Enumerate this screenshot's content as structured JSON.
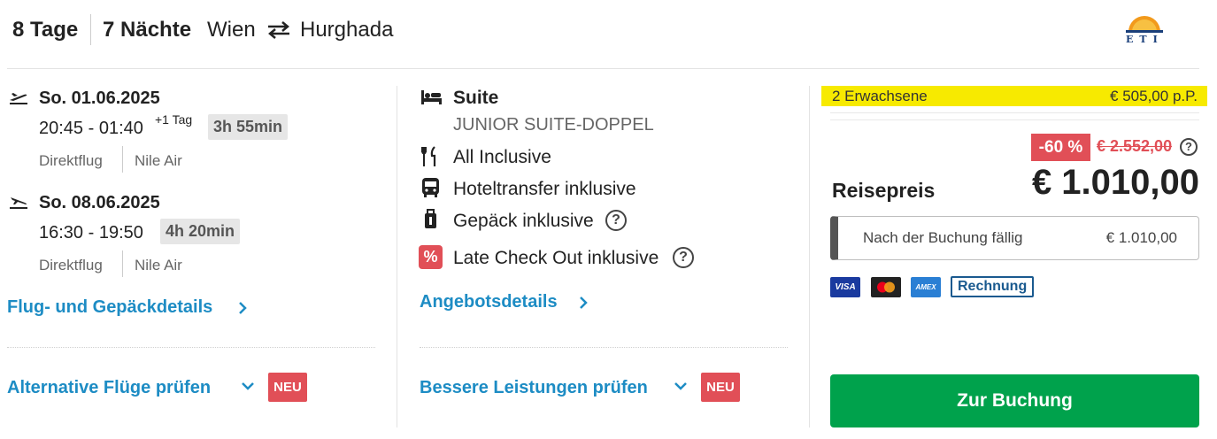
{
  "header": {
    "days": "8 Tage",
    "nights": "7 Nächte",
    "from": "Wien",
    "to": "Hurghada",
    "route_icon": "swap-arrows-icon",
    "logo_text": "ETI"
  },
  "flights": [
    {
      "direction_icon": "plane-departure-icon",
      "date": "So. 01.06.2025",
      "time": "20:45 - 01:40",
      "next_day": "+1 Tag",
      "duration": "3h 55min",
      "type": "Direktflug",
      "airline": "Nile Air"
    },
    {
      "direction_icon": "plane-arrival-icon",
      "date": "So. 08.06.2025",
      "time": "16:30 - 19:50",
      "next_day": "",
      "duration": "4h 20min",
      "type": "Direktflug",
      "airline": "Nile Air"
    }
  ],
  "links": {
    "flight_details": "Flug- und Gepäckdetails",
    "alt_flights": "Alternative Flüge prüfen",
    "offer_details": "Angebotsdetails",
    "better_services": "Bessere Leistungen prüfen",
    "new_badge": "NEU"
  },
  "hotel": {
    "room_type": "Suite",
    "room_name": "JUNIOR SUITE-DOPPEL",
    "board": "All Inclusive",
    "transfer": "Hoteltransfer inklusive",
    "luggage": "Gepäck inklusive",
    "late_checkout": "Late Check Out inklusive",
    "percent_symbol": "%",
    "help_symbol": "?"
  },
  "price": {
    "travellers": "2 Erwachsene",
    "per_person": "€ 505,00 p.P.",
    "discount": "-60 %",
    "old_price": "€ 2.552,00",
    "label": "Reisepreis",
    "total": "€ 1.010,00",
    "due_label": "Nach der Buchung fällig",
    "due_amount": "€ 1.010,00",
    "highlight_color": "#f7ea00",
    "discount_color": "#e14f57"
  },
  "payment": {
    "visa": "VISA",
    "mastercard": "",
    "amex": "AMEX",
    "invoice": "Rechnung"
  },
  "actions": {
    "book": "Zur Buchung",
    "book_color": "#00a24c"
  }
}
